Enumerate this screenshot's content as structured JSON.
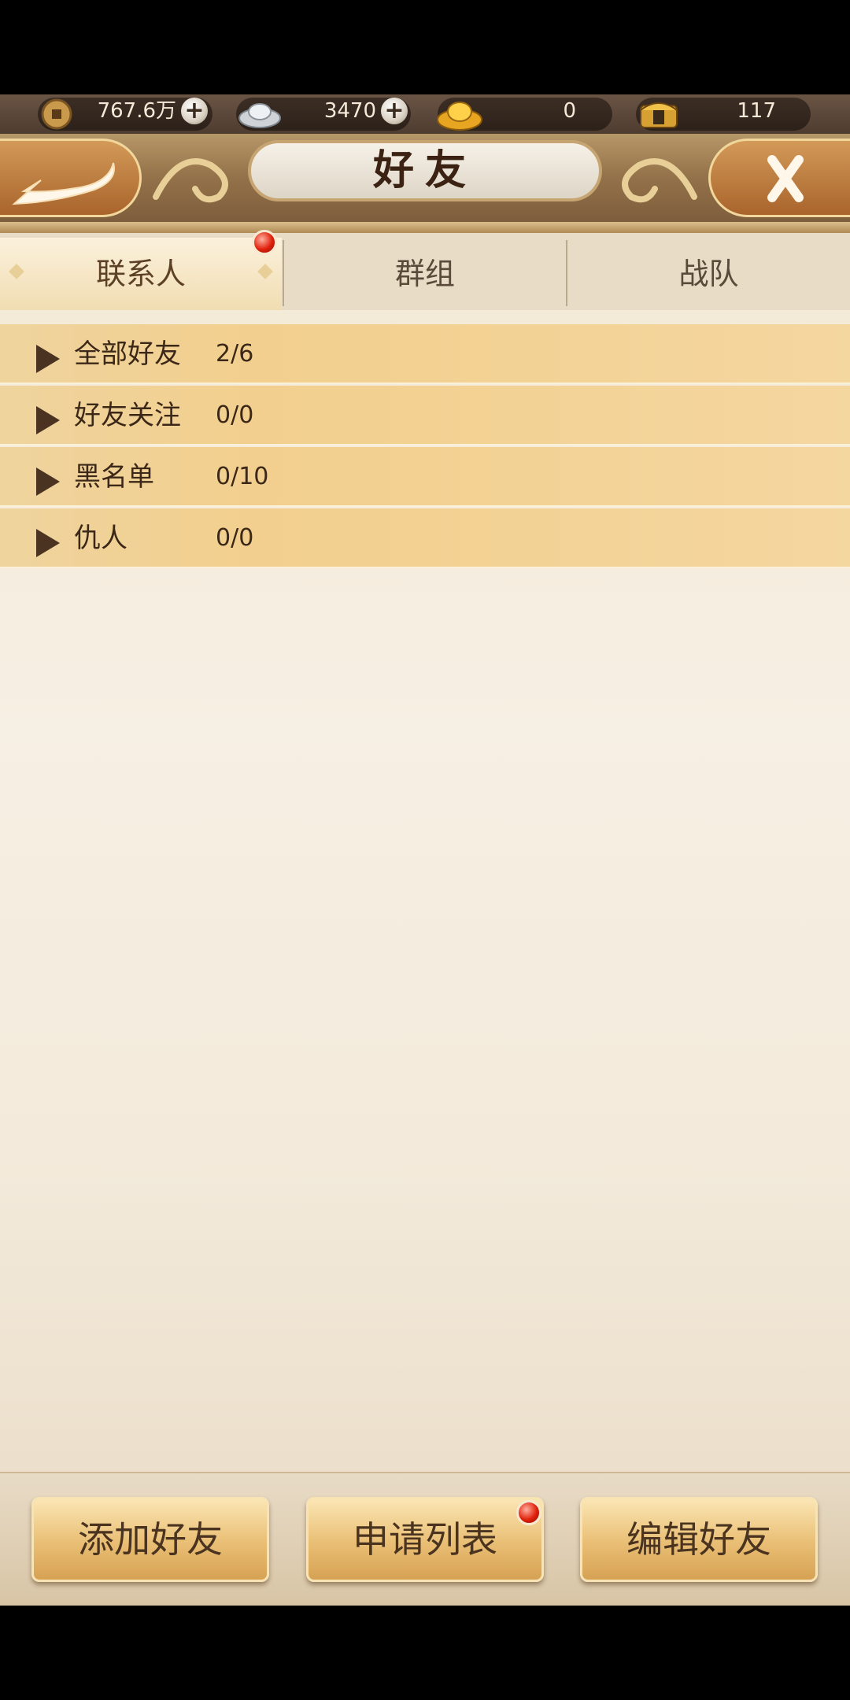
{
  "currency": {
    "copper": "767.6万",
    "silver": "3470",
    "gold": "0",
    "tickets": "117"
  },
  "header": {
    "title": "好友"
  },
  "tabs": [
    {
      "label": "联系人",
      "active": true,
      "badge": true
    },
    {
      "label": "群组",
      "active": false
    },
    {
      "label": "战队",
      "active": false
    }
  ],
  "list": [
    {
      "label": "全部好友",
      "count": "2/6"
    },
    {
      "label": "好友关注",
      "count": "0/0"
    },
    {
      "label": "黑名单",
      "count": "0/10"
    },
    {
      "label": "仇人",
      "count": "0/0"
    }
  ],
  "buttons": {
    "add_friend": "添加好友",
    "request_list": "申请列表",
    "edit_friend": "编辑好友"
  },
  "icons": [
    "copper-coin-icon",
    "silver-ingot-icon",
    "gold-ingot-icon",
    "treasure-chest-icon",
    "back-arrow-icon",
    "close-icon",
    "expand-arrow-icon"
  ],
  "colors": {
    "accent": "#e9be74",
    "badge": "#e0210c",
    "text": "#3c2818"
  }
}
